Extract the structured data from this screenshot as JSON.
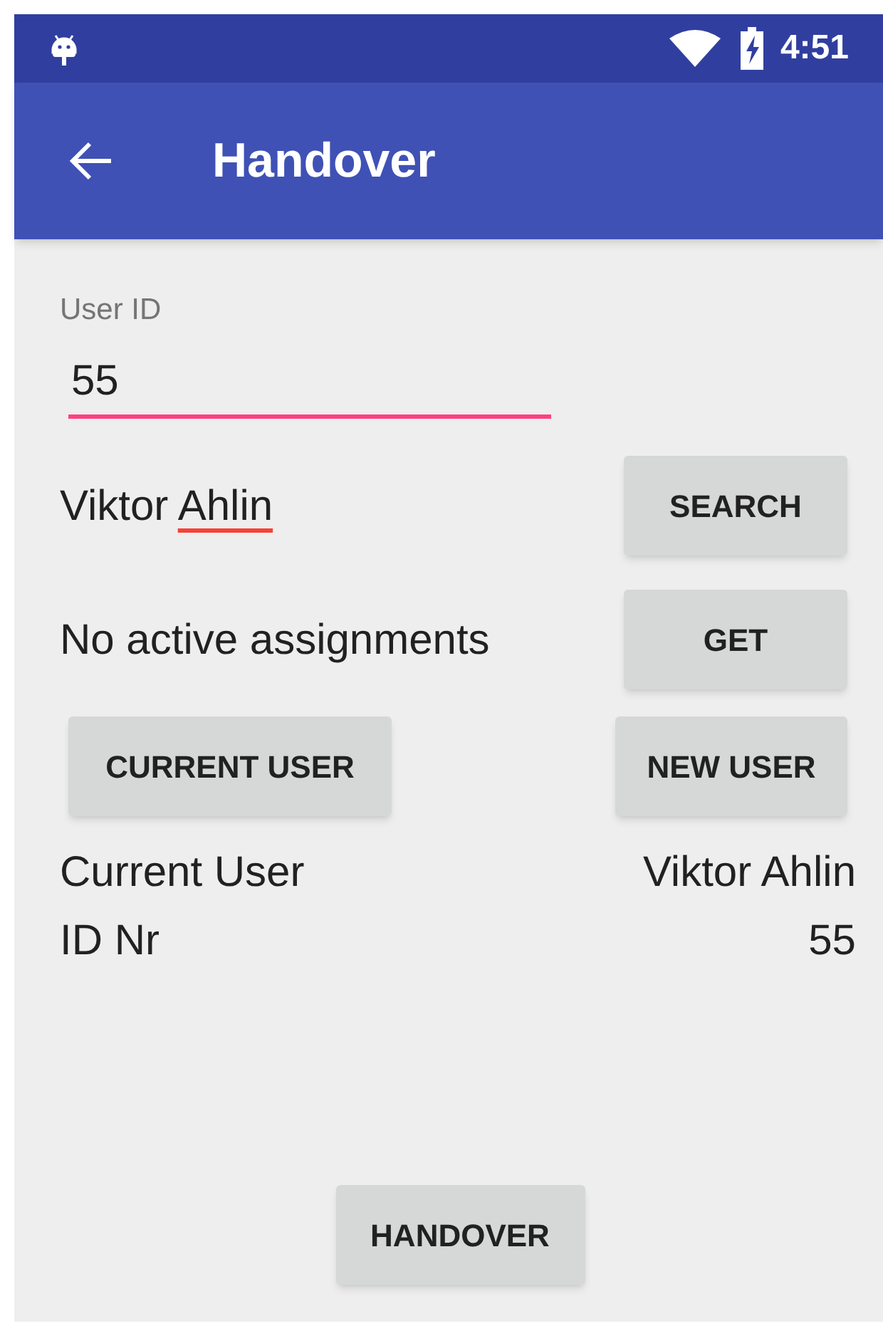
{
  "status_bar": {
    "time": "4:51"
  },
  "toolbar": {
    "title": "Handover"
  },
  "user_id": {
    "label": "User ID",
    "value": "55"
  },
  "found_user": {
    "parts": [
      {
        "text": "Viktor",
        "misspelled": false
      },
      {
        "text": "Ahlin",
        "misspelled": true
      }
    ]
  },
  "search_button": "SEARCH",
  "assignments_text": "No active assignments",
  "get_button": "GET",
  "user_buttons": [
    "CURRENT USER",
    "NEW USER"
  ],
  "details": [
    {
      "label": "Current User",
      "value": "Viktor Ahlin"
    },
    {
      "label": "ID Nr",
      "value": "55"
    }
  ],
  "handover_button": "HANDOVER"
}
